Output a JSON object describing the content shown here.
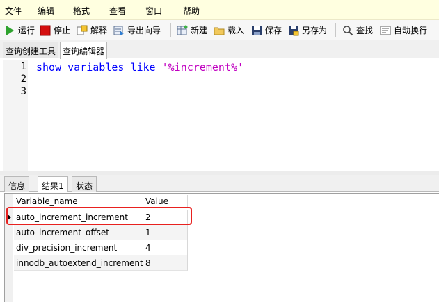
{
  "menu": {
    "items": [
      "文件",
      "编辑",
      "格式",
      "查看",
      "窗口",
      "帮助"
    ]
  },
  "toolbar": {
    "run": "运行",
    "stop": "停止",
    "explain": "解释",
    "export_wizard": "导出向导",
    "new": "新建",
    "load": "载入",
    "save": "保存",
    "save_as": "另存为",
    "find": "查找",
    "word_wrap": "自动换行"
  },
  "editor_tabs": [
    "查询创建工具",
    "查询编辑器"
  ],
  "editor": {
    "line_numbers": [
      "1",
      "2",
      "3"
    ],
    "sql_keyword_1": "show",
    "sql_keyword_2": "variables",
    "sql_keyword_3": "like",
    "sql_string": "'%increment%'"
  },
  "result_tabs": [
    "信息",
    "结果1",
    "状态"
  ],
  "grid": {
    "columns": [
      "Variable_name",
      "Value"
    ],
    "rows": [
      [
        "auto_increment_increment",
        "2"
      ],
      [
        "auto_increment_offset",
        "1"
      ],
      [
        "div_precision_increment",
        "4"
      ],
      [
        "innodb_autoextend_increment",
        "8"
      ]
    ]
  },
  "colors": {
    "menu_bg": "#ffffe0",
    "keyword": "#0000ff",
    "string": "#c000c0",
    "highlight_box": "#e8211f"
  }
}
